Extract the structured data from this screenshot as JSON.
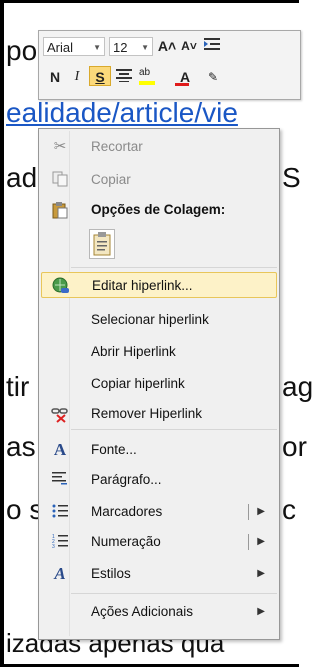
{
  "document": {
    "fragments": [
      "po",
      "ealidade/article/vie",
      "ad",
      "S",
      "tir",
      "ag",
      "as",
      "or",
      "o s",
      "c",
      "izadas apenas qua"
    ]
  },
  "toolbar": {
    "font_name": "Arial",
    "font_size": "12",
    "grow_font": "A˄",
    "shrink_font": "A˅",
    "bold": "N",
    "italic": "I",
    "underline": "S",
    "highlight": "ab",
    "font_color": "A"
  },
  "menu": {
    "items": [
      {
        "label": "Recortar",
        "icon": "scissors-icon",
        "enabled": false
      },
      {
        "label": "Copiar",
        "icon": "copy-icon",
        "enabled": false
      },
      {
        "label": "Opções de Colagem:",
        "icon": "paste-icon",
        "heading": true
      },
      {
        "label": "Editar hiperlink...",
        "icon": "edit-hyperlink-icon",
        "highlighted": true
      },
      {
        "label": "Selecionar hiperlink"
      },
      {
        "label": "Abrir Hiperlink"
      },
      {
        "label": "Copiar hiperlink"
      },
      {
        "label": "Remover Hiperlink",
        "icon": "remove-hyperlink-icon"
      },
      {
        "label": "Fonte...",
        "icon": "font-icon"
      },
      {
        "label": "Parágrafo...",
        "icon": "paragraph-icon"
      },
      {
        "label": "Marcadores",
        "icon": "bullets-icon",
        "submenu": true,
        "split": true
      },
      {
        "label": "Numeração",
        "icon": "numbering-icon",
        "submenu": true,
        "split": true
      },
      {
        "label": "Estilos",
        "icon": "styles-icon",
        "submenu": true
      },
      {
        "label": "Ações Adicionais",
        "submenu": true
      }
    ]
  },
  "colors": {
    "hover_bg": "#fdf2c8",
    "hover_border": "#e8c65a",
    "link": "#1a57c5",
    "menu_bg": "#f0f0f0"
  }
}
